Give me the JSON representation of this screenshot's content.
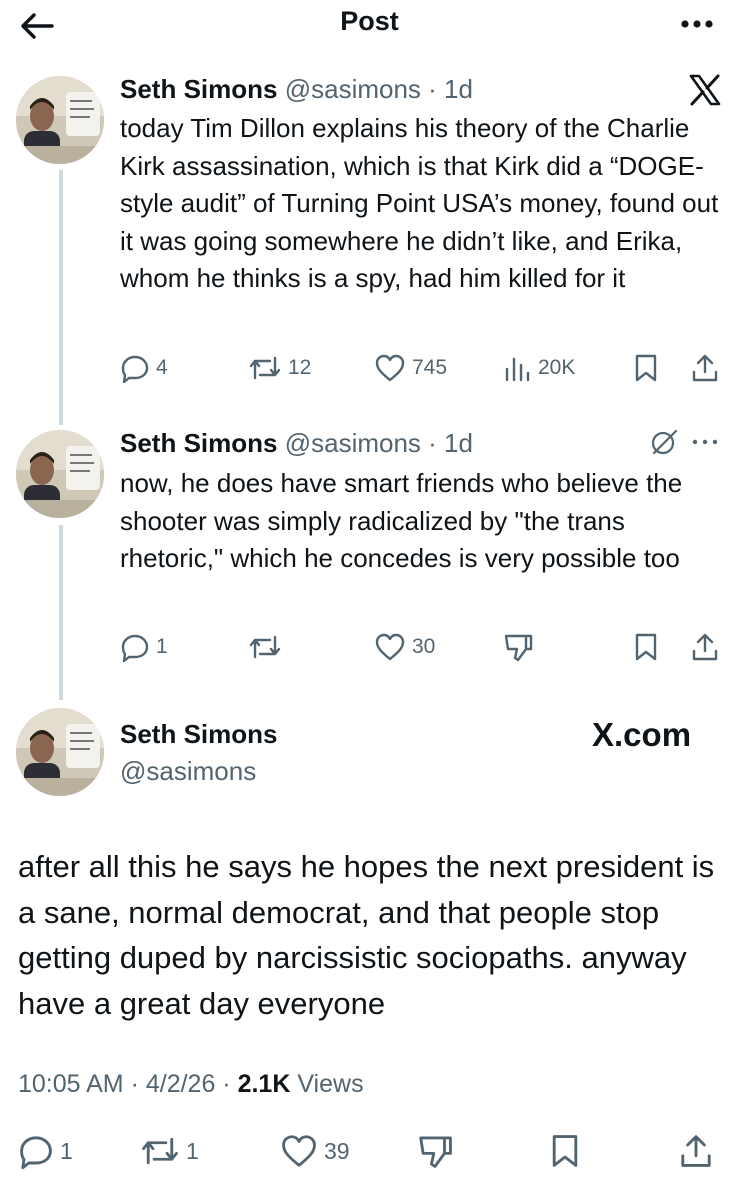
{
  "header": {
    "title": "Post"
  },
  "posts": [
    {
      "name": "Seth Simons",
      "handle": "@sasimons",
      "time": "· 1d",
      "text": "today Tim Dillon explains his theory of the Charlie Kirk assassination, which is that Kirk did a “DOGE-style audit” of Turning Point USA’s money, found out it was going somewhere he didn’t like, and Erika, whom he thinks is a spy, had him killed for it",
      "replies": "4",
      "reposts": "12",
      "likes": "745",
      "views": "20K"
    },
    {
      "name": "Seth Simons",
      "handle": "@sasimons",
      "time": "· 1d",
      "text": "now, he does have smart friends who believe the shooter was simply radicalized by \"the trans rhetoric,\" which he concedes is very possible too",
      "replies": "1",
      "reposts": "",
      "likes": "30"
    }
  ],
  "main_post": {
    "name": "Seth Simons",
    "handle": "@sasimons",
    "brand": "X.com",
    "text": "after all this he says he hopes the next president is a sane, normal democrat, and that people stop getting duped by narcissistic sociopaths. anyway have a great day everyone",
    "time": "10:05 AM · 4/2/26 · ",
    "views_count": "2.1K",
    "views_label": " Views",
    "replies": "1",
    "reposts": "1",
    "likes": "39"
  },
  "icons": {
    "back": "arrow-left-icon",
    "more": "more-horizontal-icon",
    "reply": "reply-icon",
    "repost": "repost-icon",
    "like": "heart-icon",
    "views": "views-chart-icon",
    "bookmark": "bookmark-icon",
    "share": "share-icon",
    "dislike": "thumbs-down-icon",
    "grok": "slash-circle-icon",
    "x_logo": "x-logo-icon"
  },
  "colors": {
    "text": "#0f1419",
    "muted": "#536471",
    "line": "#cfd9de"
  }
}
